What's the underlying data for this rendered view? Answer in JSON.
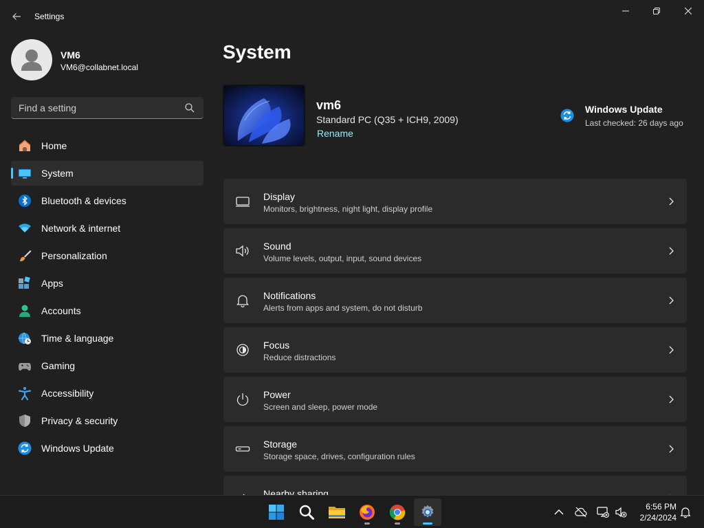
{
  "window": {
    "title": "Settings",
    "back_icon": "back-arrow-icon",
    "controls": [
      "minimize-icon",
      "restore-icon",
      "close-icon"
    ]
  },
  "user": {
    "name": "VM6",
    "email": "VM6@collabnet.local"
  },
  "search": {
    "placeholder": "Find a setting",
    "icon": "search-icon"
  },
  "sidebar": {
    "items": [
      {
        "label": "Home",
        "icon": "home-icon",
        "active": false
      },
      {
        "label": "System",
        "icon": "monitor-icon",
        "active": true
      },
      {
        "label": "Bluetooth & devices",
        "icon": "bluetooth-icon",
        "active": false
      },
      {
        "label": "Network & internet",
        "icon": "wifi-icon",
        "active": false
      },
      {
        "label": "Personalization",
        "icon": "brush-icon",
        "active": false
      },
      {
        "label": "Apps",
        "icon": "apps-icon",
        "active": false
      },
      {
        "label": "Accounts",
        "icon": "person-icon",
        "active": false
      },
      {
        "label": "Time & language",
        "icon": "globe-clock-icon",
        "active": false
      },
      {
        "label": "Gaming",
        "icon": "gamepad-icon",
        "active": false
      },
      {
        "label": "Accessibility",
        "icon": "accessibility-icon",
        "active": false
      },
      {
        "label": "Privacy & security",
        "icon": "shield-icon",
        "active": false
      },
      {
        "label": "Windows Update",
        "icon": "update-icon",
        "active": false
      }
    ]
  },
  "main": {
    "title": "System",
    "device": {
      "name": "vm6",
      "model": "Standard PC (Q35 + ICH9, 2009)",
      "rename_label": "Rename"
    },
    "windows_update": {
      "title": "Windows Update",
      "status": "Last checked: 26 days ago"
    },
    "cards": [
      {
        "title": "Display",
        "subtitle": "Monitors, brightness, night light, display profile",
        "icon": "display-icon"
      },
      {
        "title": "Sound",
        "subtitle": "Volume levels, output, input, sound devices",
        "icon": "speaker-icon"
      },
      {
        "title": "Notifications",
        "subtitle": "Alerts from apps and system, do not disturb",
        "icon": "bell-icon"
      },
      {
        "title": "Focus",
        "subtitle": "Reduce distractions",
        "icon": "focus-icon"
      },
      {
        "title": "Power",
        "subtitle": "Screen and sleep, power mode",
        "icon": "power-icon"
      },
      {
        "title": "Storage",
        "subtitle": "Storage space, drives, configuration rules",
        "icon": "storage-icon"
      },
      {
        "title": "Nearby sharing",
        "subtitle": "",
        "icon": "share-icon"
      }
    ]
  },
  "taskbar": {
    "apps": [
      {
        "name": "start-icon"
      },
      {
        "name": "search-taskbar-icon"
      },
      {
        "name": "file-explorer-icon"
      },
      {
        "name": "firefox-icon"
      },
      {
        "name": "chrome-icon"
      },
      {
        "name": "settings-app-icon"
      }
    ],
    "tray": [
      "chevron-up-icon",
      "cloud-offline-icon",
      "network-disconnected-icon",
      "volume-muted-icon"
    ],
    "time": "6:56 PM",
    "date": "2/24/2024",
    "notification_icon": "notification-bell-icon"
  },
  "colors": {
    "accent": "#4cc2ff",
    "link": "#99ebff",
    "background": "#202020",
    "card": "#2b2b2b"
  }
}
